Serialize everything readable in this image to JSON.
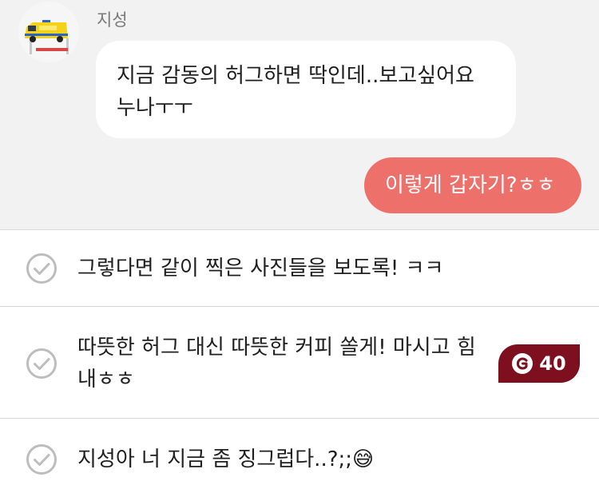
{
  "chat": {
    "sender_name": "지성",
    "incoming_message": "지금 감동의 허그하면 딱인데..보고싶어요 누나ㅜㅜ",
    "outgoing_message": "이렇게 갑자기?ㅎㅎ"
  },
  "reply_options": [
    {
      "text": "그렇다면 같이 찍은 사진들을 보도록! ㅋㅋ"
    },
    {
      "text": "따뜻한 허그 대신 따뜻한 커피 쏠게! 마시고 힘내ㅎㅎ",
      "cost": "40",
      "cost_icon": "coin-icon"
    },
    {
      "text": "지성아 너 지금 좀 징그럽다..?;;😅"
    }
  ],
  "colors": {
    "chat_background": "#f2f2f2",
    "outgoing_bubble": "#ee706b",
    "cost_badge": "#7d0f1e",
    "checkmark": "#bdbdbd"
  }
}
